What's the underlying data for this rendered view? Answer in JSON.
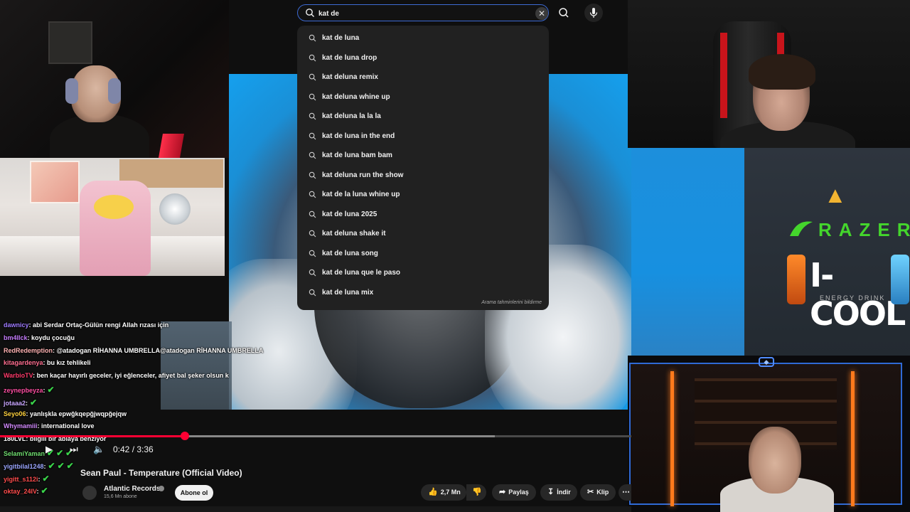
{
  "search": {
    "query": "kat de ",
    "clear_icon": "close-icon",
    "search_icon": "search-icon",
    "mic_icon": "microphone-icon"
  },
  "suggestions": [
    "kat de luna",
    "kat de luna drop",
    "kat deluna remix",
    "kat deluna whine up",
    "kat deluna la la la",
    "kat de luna in the end",
    "kat de luna bam bam",
    "kat deluna run the show",
    "kat de la luna whine up",
    "kat de luna 2025",
    "kat deluna shake it",
    "kat de luna song",
    "kat de luna que le paso",
    "kat de luna mix"
  ],
  "suggestions_footer": "Arama tahminlerini bildirme",
  "chat": [
    {
      "user": "dawnicy",
      "text": ": abi Serdar Ortaç-Gülün rengi Allah rızası için",
      "color": "#9f7bff"
    },
    {
      "user": "bm4llck",
      "text": ": koydu çocuğu",
      "color": "#c77dff"
    },
    {
      "user": "RedRedemption",
      "text": ": @atadogan RİHANNA UMBRELLA@atadogan RİHANNA UMBRELLA",
      "color": "#ffb3b3"
    },
    {
      "user": "kitagardenya",
      "text": ": bu kız tehlikeli",
      "color": "#ff6f91"
    },
    {
      "user": "WarbioTV",
      "text": ": ben kaçar hayırlı geceler, iyi eğlenceler, afiyet bal şeker olsun k",
      "color": "#ff3b6b"
    },
    {
      "user": "zeynepbeyza",
      "text": ":",
      "color": "#ff4fa3"
    },
    {
      "user": "jotaaa2",
      "text": ":",
      "color": "#c9a6ff"
    },
    {
      "user": "Seyo06",
      "text": ": yanlışkla epwğkqepğjwqpğejqw",
      "color": "#ffd23f"
    },
    {
      "user": "Whymamiii",
      "text": ": international love",
      "color": "#d48bff"
    },
    {
      "user": "180LVL",
      "text": ": bilgili bir ablaya benziyor",
      "color": "#ffffff"
    },
    {
      "user": "SelamiYaman",
      "text": "",
      "color": "#6fdc6f"
    },
    {
      "user": "yigitbilal1248",
      "text": ":",
      "color": "#9ba6ff"
    },
    {
      "user": "yigitt_s112i",
      "text": ":",
      "color": "#ff4d4d"
    },
    {
      "user": "oktay_24IV",
      "text": ":",
      "color": "#ff4d4d"
    }
  ],
  "player": {
    "time": "0:42 / 3:36",
    "progress_fraction": 0.2
  },
  "video": {
    "title": "Sean Paul - Temperature (Official Video)",
    "channel": "Atlantic Records",
    "subscribers": "15,6 Mn abone",
    "subscribe_label": "Abone ol",
    "likes": "2,7 Mn",
    "share_label": "Paylaş",
    "download_label": "İndir",
    "clip_label": "Klip"
  },
  "sponsor": {
    "brand1": "RAZER",
    "brand2": "I-COOL",
    "brand2_tagline": "ENERGY DRINK"
  },
  "colors": {
    "accent": "#ff0033",
    "search_border": "#3d6ad3",
    "razer_green": "#44d62c"
  }
}
